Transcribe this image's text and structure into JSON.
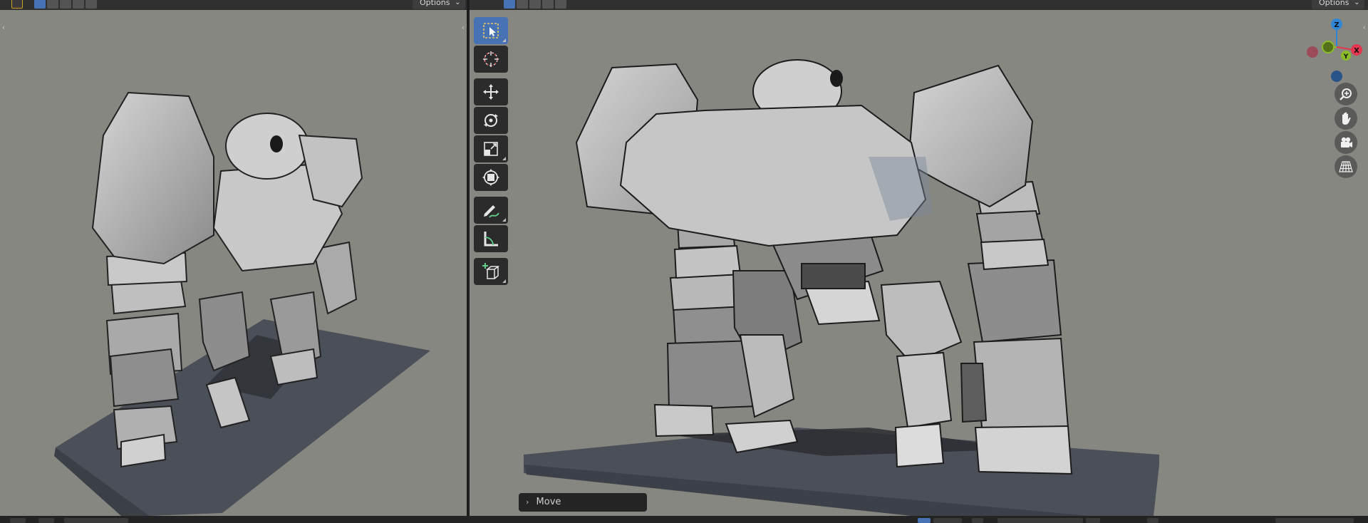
{
  "viewport_left": {
    "header": {
      "options_label": "Options",
      "chevron": "⌄"
    }
  },
  "viewport_right": {
    "header": {
      "options_label": "Options",
      "chevron": "⌄"
    },
    "toolbar": {
      "tools": [
        {
          "name": "select-box",
          "icon": "select-box-icon",
          "active": true
        },
        {
          "name": "cursor",
          "icon": "cursor-icon"
        },
        {
          "name": "move",
          "icon": "move-icon"
        },
        {
          "name": "rotate",
          "icon": "rotate-icon"
        },
        {
          "name": "scale",
          "icon": "scale-icon"
        },
        {
          "name": "transform",
          "icon": "transform-icon"
        },
        {
          "name": "annotate",
          "icon": "annotate-icon"
        },
        {
          "name": "measure",
          "icon": "measure-icon"
        },
        {
          "name": "add-cube",
          "icon": "add-cube-icon"
        }
      ]
    },
    "gizmo": {
      "x_label": "X",
      "y_label": "Y",
      "z_label": "Z"
    },
    "last_operator": {
      "label": "Move",
      "chevron": "›"
    },
    "nav_buttons": [
      "zoom-icon",
      "pan-hand-icon",
      "camera-icon",
      "grid-perspective-icon"
    ]
  },
  "colors": {
    "viewport_bg": "#878782",
    "header_bg": "#303030",
    "accent": "#4772b3",
    "axis_x": "#e2374e",
    "axis_y": "#8bbb27",
    "axis_z": "#2f86d6"
  }
}
